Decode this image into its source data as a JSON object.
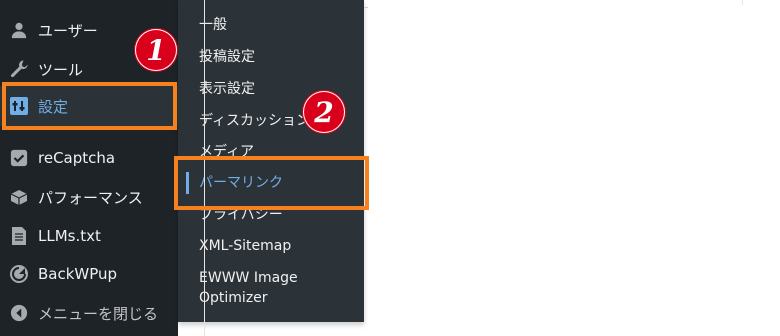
{
  "sidebar": {
    "items": [
      {
        "label": "ユーザー",
        "icon": "user-icon"
      },
      {
        "label": "ツール",
        "icon": "wrench-icon"
      },
      {
        "label": "設定",
        "icon": "settings-sliders-icon"
      },
      {
        "label": "reCaptcha",
        "icon": "checkbox-icon"
      },
      {
        "label": "パフォーマンス",
        "icon": "performance-icon"
      },
      {
        "label": "LLMs.txt",
        "icon": "document-icon"
      },
      {
        "label": "BackWPup",
        "icon": "backwpup-icon"
      },
      {
        "label": "メニューを閉じる",
        "icon": "collapse-arrow-icon"
      }
    ]
  },
  "submenu": {
    "items": [
      {
        "label": "一般"
      },
      {
        "label": "投稿設定"
      },
      {
        "label": "表示設定"
      },
      {
        "label": "ディスカッション"
      },
      {
        "label": "メディア"
      },
      {
        "label": "パーマリンク"
      },
      {
        "label": "プライバシー"
      },
      {
        "label": "XML-Sitemap"
      },
      {
        "label": "EWWW Image Optimizer"
      }
    ]
  },
  "annotations": {
    "step1": "1",
    "step2": "2",
    "highlight_color": "#f5821f",
    "badge_color": "#d9001b"
  },
  "colors": {
    "sidebar_bg": "#1d2327",
    "submenu_bg": "#2c3338",
    "active_text": "#72aee6"
  }
}
